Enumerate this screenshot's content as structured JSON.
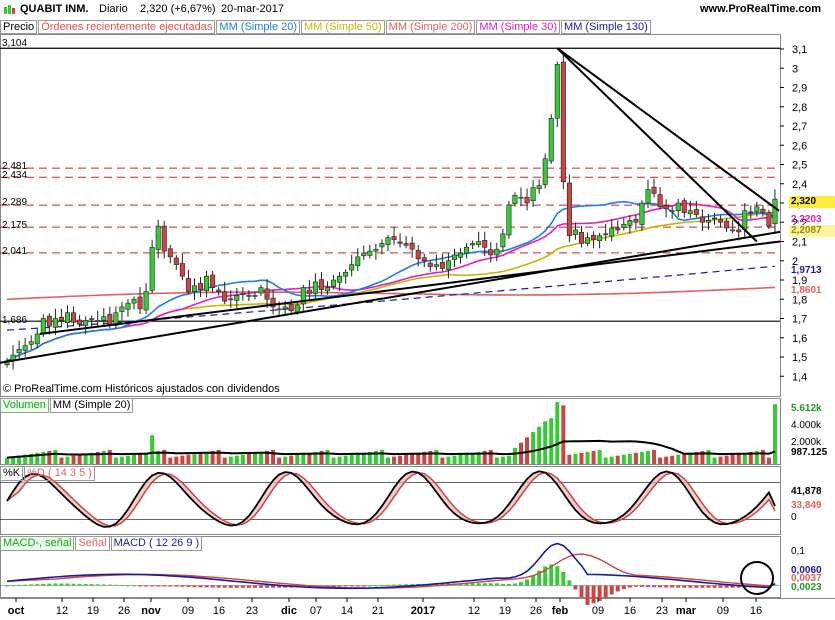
{
  "header": {
    "symbol": "QUABIT INM.",
    "period": "Diario",
    "price_change": "2,320 (+6,67%)",
    "date": "20-mar-2017",
    "site": "www.ProRealTime.com"
  },
  "price_legend": {
    "precio": "Precio",
    "ordenes": "Órdenes recientemente ejecutadas",
    "mm20": "MM (Simple 20)",
    "mm50": "MM (Simple 50)",
    "mm200": "MM (Simple 200)",
    "mm30": "MM (Simple 30)",
    "mm130": "MM (Simple 130)"
  },
  "colors": {
    "up": "#33cc33",
    "down": "#cc4444",
    "mm20": "#1f7ee0",
    "mm50": "#c8b400",
    "mm200": "#e06060",
    "mm30": "#e020c0",
    "mm130": "#1a1aa0",
    "hist_up": "#33cc33",
    "hist_down": "#cc4444"
  },
  "footer_note": "© ProRealTime.com  Históricos ajustados con dividendos",
  "price_levels_left": [
    "3,104",
    "2,481",
    "2,434",
    "2,289",
    "2,175",
    "2,041",
    "1,686"
  ],
  "price_axis_ticks": [
    "3,1",
    "3",
    "2,9",
    "2,8",
    "2,7",
    "2,6",
    "2,5",
    "2,4",
    "2,3",
    "2,2",
    "2,1",
    "2",
    "1,9",
    "1,8",
    "1,7",
    "1,6",
    "1,5",
    "1,4"
  ],
  "price_right_labels": {
    "last": "2,320",
    "mm30": "2,2203",
    "mm50": "2,2087",
    "mm130": "1,9713",
    "mm200": "1,8601"
  },
  "volume_legend": {
    "vol": "Volumen",
    "mm": "MM (Simple 20)"
  },
  "volume_right_labels": {
    "last": "5.612k",
    "tick1": "4.000k",
    "tick2": "2.000k",
    "mm": "987.125"
  },
  "stoch_legend": {
    "k": "%K",
    "d": "%D ( 14 3 5 )"
  },
  "stoch_right_labels": {
    "k": "41,878",
    "d": "33,849",
    "zero": "0"
  },
  "macd_legend": {
    "hist": "MACD-, señal",
    "signal": "Señal",
    "macd": "MACD ( 12 26 9 )"
  },
  "macd_right_labels": {
    "tick": "0,1",
    "macd": "0,0060",
    "signal": "0,0037",
    "hist": "0,0023",
    "zero": "0"
  },
  "x_axis_labels": [
    "oct",
    "12",
    "19",
    "26",
    "nov",
    "09",
    "16",
    "23",
    "dic",
    "07",
    "14",
    "21",
    "2017",
    "12",
    "19",
    "26",
    "feb",
    "09",
    "16",
    "23",
    "mar",
    "09",
    "16"
  ],
  "chart_data": {
    "type": "candlestick",
    "title": "QUABIT INM. Diario",
    "y_range": [
      1.4,
      3.15
    ],
    "closes": [
      1.48,
      1.51,
      1.54,
      1.56,
      1.58,
      1.62,
      1.7,
      1.66,
      1.7,
      1.69,
      1.73,
      1.68,
      1.67,
      1.69,
      1.7,
      1.69,
      1.71,
      1.67,
      1.73,
      1.76,
      1.78,
      1.8,
      1.75,
      1.84,
      2.07,
      2.18,
      2.05,
      2.02,
      1.98,
      1.92,
      1.84,
      1.87,
      1.85,
      1.92,
      1.86,
      1.84,
      1.79,
      1.8,
      1.82,
      1.83,
      1.82,
      1.82,
      1.86,
      1.8,
      1.76,
      1.75,
      1.76,
      1.74,
      1.77,
      1.86,
      1.83,
      1.89,
      1.85,
      1.86,
      1.9,
      1.92,
      1.94,
      1.98,
      2.02,
      2.04,
      2.05,
      2.06,
      2.09,
      2.12,
      2.11,
      2.09,
      2.08,
      2.06,
      2.01,
      2.0,
      1.97,
      1.98,
      1.96,
      2.0,
      2.03,
      2.04,
      2.07,
      2.09,
      2.1,
      2.07,
      2.03,
      2.06,
      2.14,
      2.29,
      2.34,
      2.33,
      2.3,
      2.38,
      2.39,
      2.53,
      2.74,
      3.02,
      2.41,
      2.13,
      2.16,
      2.09,
      2.12,
      2.11,
      2.13,
      2.14,
      2.17,
      2.16,
      2.19,
      2.21,
      2.2,
      2.3,
      2.37,
      2.35,
      2.28,
      2.27,
      2.26,
      2.3,
      2.25,
      2.26,
      2.24,
      2.2,
      2.21,
      2.22,
      2.2,
      2.17,
      2.16,
      2.15,
      2.26,
      2.25,
      2.28,
      2.25,
      2.18,
      2.32
    ],
    "volume_last": "5.612k",
    "stochastic": {
      "k_last": 41.878,
      "d_last": 33.849,
      "k_params": "14 3 5"
    },
    "macd": {
      "params": "12 26 9",
      "macd_last": 0.006,
      "signal_last": 0.0037,
      "hist_last": 0.0023
    }
  }
}
